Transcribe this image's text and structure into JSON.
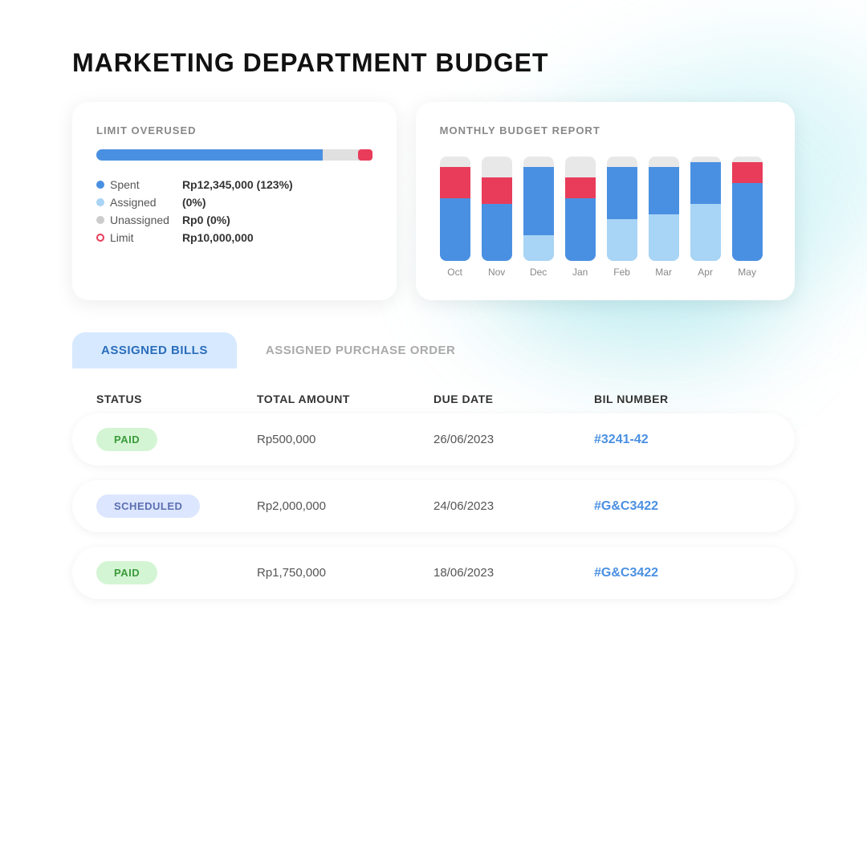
{
  "page": {
    "title": "MARKETING DEPARTMENT BUDGET"
  },
  "limit_card": {
    "label": "LIMIT OVERUSED",
    "progress_fill_pct": 82,
    "legend": [
      {
        "key": "Spent",
        "dot": "blue",
        "value": "Rp12,345,000 (123%)"
      },
      {
        "key": "Assigned",
        "dot": "lightblue",
        "value": "(0%)"
      },
      {
        "key": "Unassigned",
        "dot": "gray",
        "value": "Rp0 (0%)"
      },
      {
        "key": "Limit",
        "dot": "red",
        "value": "Rp10,000,000"
      }
    ]
  },
  "monthly_card": {
    "label": "MONTHLY BUDGET REPORT",
    "bars": [
      {
        "month": "Oct",
        "red": 30,
        "blue": 60,
        "light": 0
      },
      {
        "month": "Nov",
        "red": 25,
        "blue": 55,
        "light": 0
      },
      {
        "month": "Dec",
        "red": 0,
        "blue": 65,
        "light": 25
      },
      {
        "month": "Jan",
        "red": 20,
        "blue": 60,
        "light": 0
      },
      {
        "month": "Feb",
        "red": 0,
        "blue": 50,
        "light": 40
      },
      {
        "month": "Mar",
        "red": 0,
        "blue": 45,
        "light": 45
      },
      {
        "month": "Apr",
        "red": 0,
        "blue": 40,
        "light": 55
      },
      {
        "month": "May",
        "red": 20,
        "blue": 75,
        "light": 0
      }
    ]
  },
  "tabs": [
    {
      "id": "assigned-bills",
      "label": "ASSIGNED BILLS",
      "active": true
    },
    {
      "id": "assigned-po",
      "label": "ASSIGNED PURCHASE ORDER",
      "active": false
    }
  ],
  "table": {
    "headers": [
      "STATUS",
      "TOTAL AMOUNT",
      "DUE DATE",
      "BIL NUMBER"
    ],
    "rows": [
      {
        "status": "PAID",
        "status_type": "paid",
        "amount": "Rp500,000",
        "due_date": "26/06/2023",
        "bill_number": "#3241-42"
      },
      {
        "status": "SCHEDULED",
        "status_type": "scheduled",
        "amount": "Rp2,000,000",
        "due_date": "24/06/2023",
        "bill_number": "#G&C3422"
      },
      {
        "status": "PAID",
        "status_type": "paid",
        "amount": "Rp1,750,000",
        "due_date": "18/06/2023",
        "bill_number": "#G&C3422"
      }
    ]
  }
}
